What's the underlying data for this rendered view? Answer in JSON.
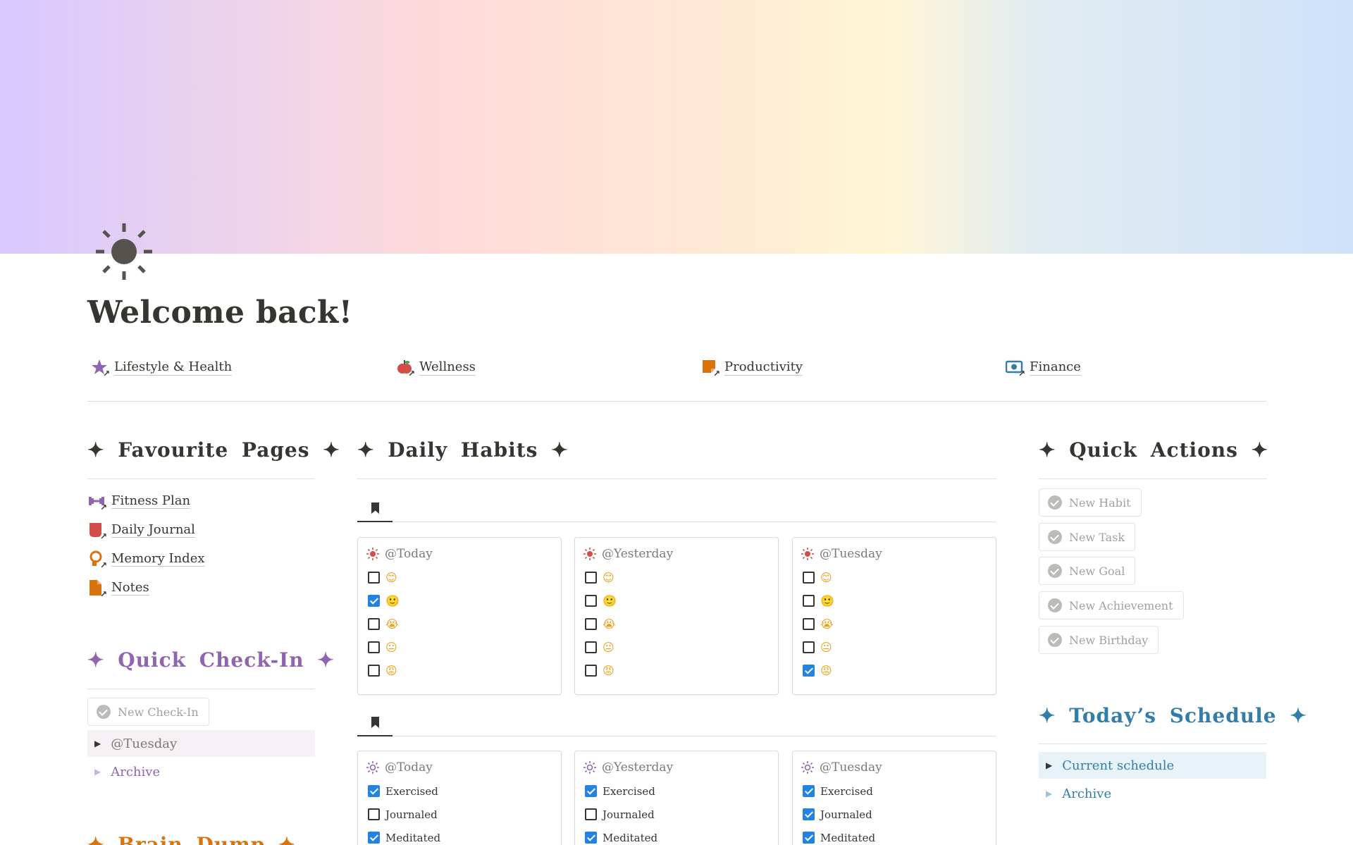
{
  "page": {
    "title": "Welcome back!",
    "icon": "sun-icon"
  },
  "categories": [
    {
      "label": "Lifestyle & Health",
      "icon": "star-link-icon",
      "color": "#9065b0"
    },
    {
      "label": "Wellness",
      "icon": "apple-link-icon",
      "color": "#d44c47"
    },
    {
      "label": "Productivity",
      "icon": "sticky-note-link-icon",
      "color": "#d9730d"
    },
    {
      "label": "Finance",
      "icon": "money-link-icon",
      "color": "#337ea9"
    }
  ],
  "favourites": {
    "heading": "✦  Favourite  Pages  ✦",
    "items": [
      {
        "label": "Fitness Plan",
        "icon": "dumbbell-link-icon",
        "color": "#9065b0"
      },
      {
        "label": "Daily Journal",
        "icon": "journal-link-icon",
        "color": "#d44c47"
      },
      {
        "label": "Memory Index",
        "icon": "head-link-icon",
        "color": "#d9730d"
      },
      {
        "label": "Notes",
        "icon": "note-link-icon",
        "color": "#d9730d"
      }
    ]
  },
  "check_in": {
    "heading": "✦  Quick  Check-In  ✦",
    "color": "#9065b0",
    "new_button": "New Check-In",
    "toggle_label": "@Tuesday",
    "archive_label": "Archive"
  },
  "daily_habits": {
    "heading": "✦  Daily  Habits  ✦",
    "mood_cards": [
      {
        "date": "@Today",
        "checks": [
          false,
          true,
          false,
          false,
          false
        ]
      },
      {
        "date": "@Yesterday",
        "checks": [
          false,
          false,
          false,
          false,
          false
        ]
      },
      {
        "date": "@Tuesday",
        "checks": [
          false,
          false,
          false,
          false,
          true
        ]
      }
    ],
    "moods": [
      "😊",
      "🙂",
      "😭",
      "😐",
      "😡"
    ],
    "habit_cards": [
      {
        "date": "@Today",
        "items": [
          {
            "label": "Exercised",
            "checked": true
          },
          {
            "label": "Journaled",
            "checked": false
          },
          {
            "label": "Meditated",
            "checked": true
          }
        ]
      },
      {
        "date": "@Yesterday",
        "items": [
          {
            "label": "Exercised",
            "checked": true
          },
          {
            "label": "Journaled",
            "checked": false
          },
          {
            "label": "Meditated",
            "checked": true
          }
        ]
      },
      {
        "date": "@Tuesday",
        "items": [
          {
            "label": "Exercised",
            "checked": true
          },
          {
            "label": "Journaled",
            "checked": true
          },
          {
            "label": "Meditated",
            "checked": true
          }
        ]
      }
    ]
  },
  "quick_actions": {
    "heading": "✦  Quick  Actions  ✦",
    "buttons": [
      "New Habit",
      "New Task",
      "New Goal",
      "New Achievement",
      "New Birthday"
    ]
  },
  "schedule": {
    "heading": "✦ Today’s Schedule ✦",
    "color": "#337ea9",
    "toggle_label": "Current schedule",
    "archive_label": "Archive"
  },
  "brain_dump": {
    "heading": "✦  Brain  Dump  ✦",
    "color": "#d9730d"
  }
}
